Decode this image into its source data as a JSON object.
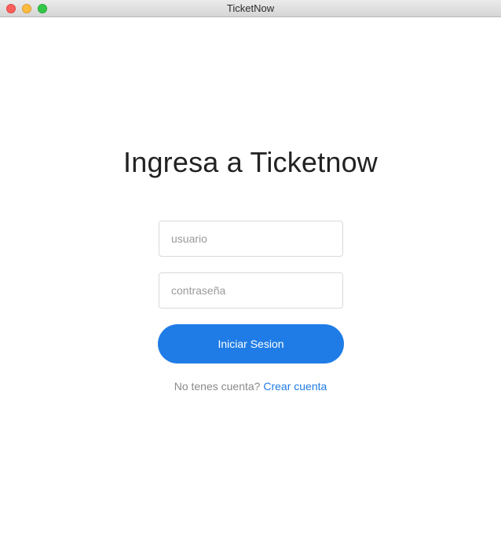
{
  "window": {
    "title": "TicketNow"
  },
  "login": {
    "heading": "Ingresa a Ticketnow",
    "username_placeholder": "usuario",
    "password_placeholder": "contraseña",
    "submit_label": "Iniciar Sesion",
    "signup_prompt": "No tenes cuenta?",
    "signup_link": "Crear cuenta"
  },
  "colors": {
    "accent": "#1f7ce6",
    "heading_text": "#222222",
    "muted_text": "#8a8a8a",
    "close_button": "#fc605c",
    "minimize_button": "#fdbc40",
    "maximize_button": "#34c84a"
  }
}
